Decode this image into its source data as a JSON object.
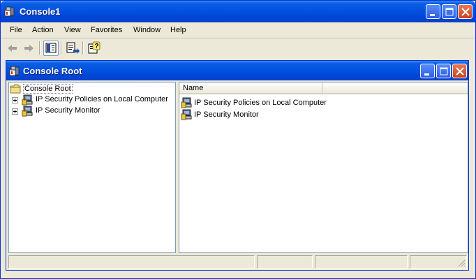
{
  "window": {
    "title": "Console1"
  },
  "menu": [
    "File",
    "Action",
    "View",
    "Favorites",
    "Window",
    "Help"
  ],
  "toolbar": {
    "buttons": [
      "back-arrow-icon",
      "forward-arrow-icon",
      "show-hide-tree-icon",
      "export-list-icon",
      "help-icon"
    ]
  },
  "child": {
    "title": "Console Root",
    "tree": {
      "root": "Console Root",
      "items": [
        {
          "label": "IP Security Policies on Local Computer"
        },
        {
          "label": "IP Security Monitor"
        }
      ]
    },
    "list": {
      "columns": [
        "Name"
      ],
      "rows": [
        {
          "name": "IP Security Policies on Local Computer"
        },
        {
          "name": "IP Security Monitor"
        }
      ]
    }
  },
  "colors": {
    "titlebar": "#0554e3",
    "close": "#c8451c",
    "face": "#ece9d8"
  }
}
